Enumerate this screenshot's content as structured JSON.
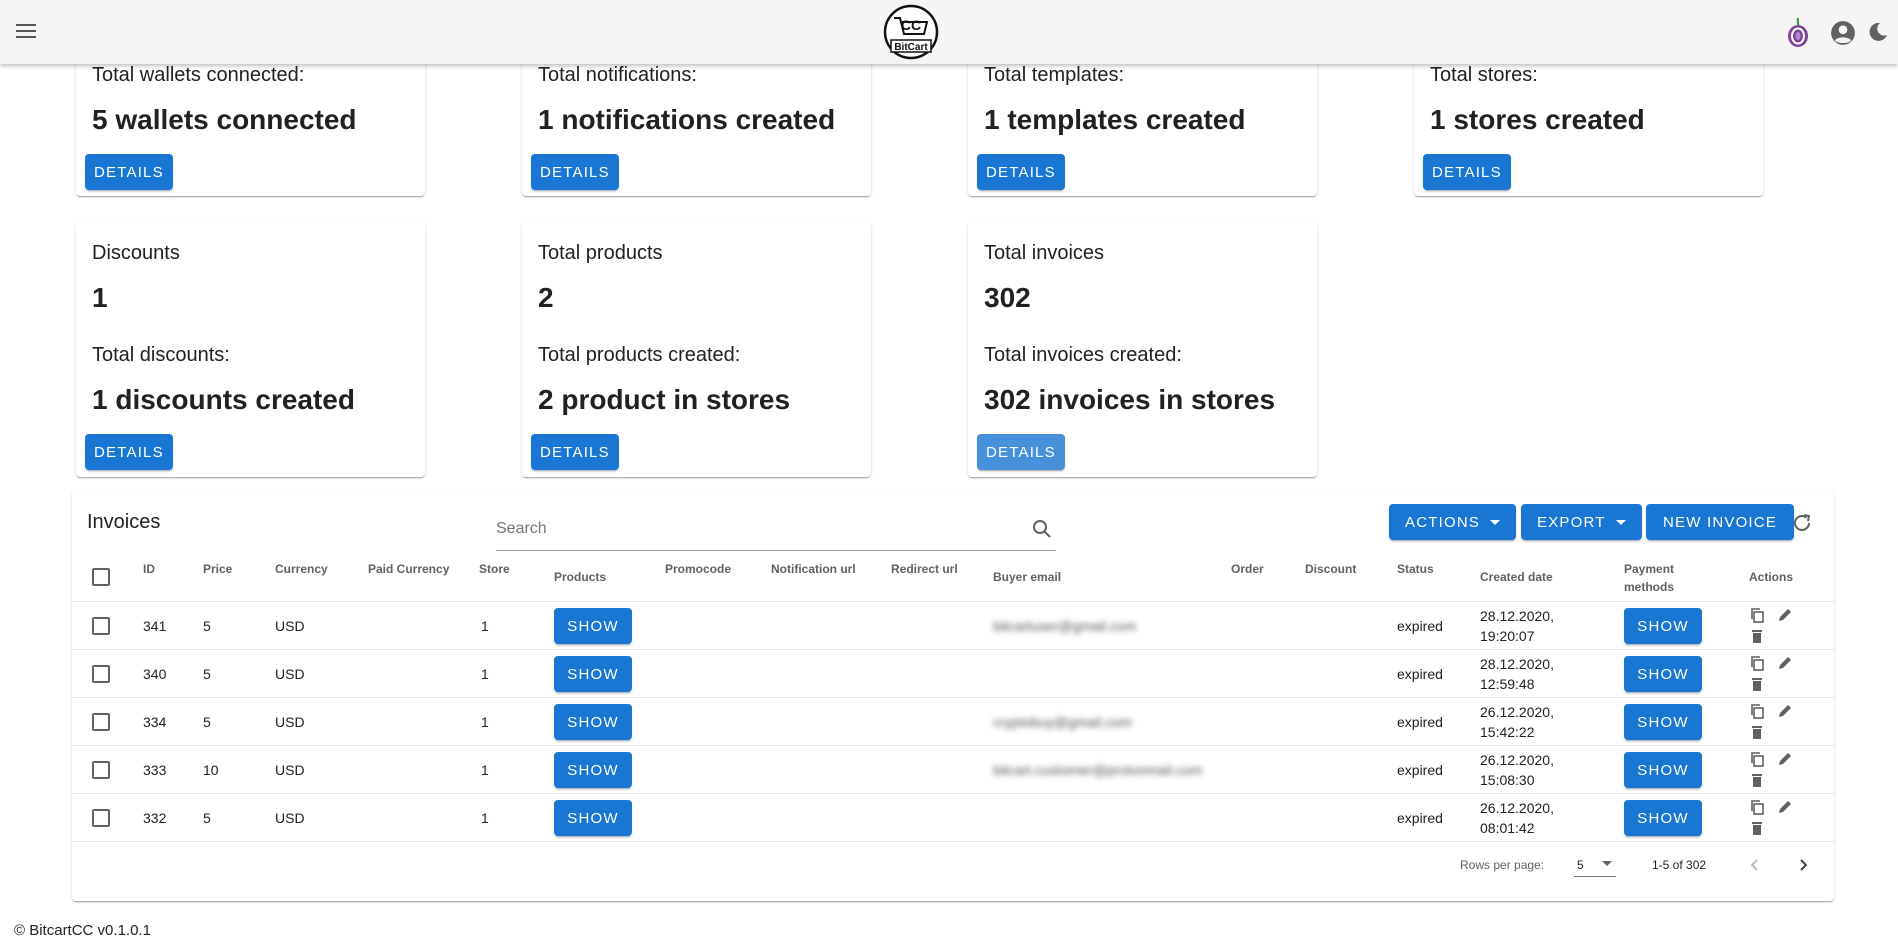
{
  "appbar": {
    "logo_text_top": "CC",
    "logo_text_bottom": "BitCart"
  },
  "cards": [
    {
      "label": "Total wallets connected:",
      "value": "5 wallets connected",
      "button": "DETAILS"
    },
    {
      "label": "Total notifications:",
      "value": "1 notifications created",
      "button": "DETAILS"
    },
    {
      "label": "Total templates:",
      "value": "1 templates created",
      "button": "DETAILS"
    },
    {
      "label": "Total stores:",
      "value": "1 stores created",
      "button": "DETAILS"
    },
    {
      "label": "Discounts",
      "count": "1",
      "label2": "Total discounts:",
      "value": "1 discounts created",
      "button": "DETAILS"
    },
    {
      "label": "Total products",
      "count": "2",
      "label2": "Total products created:",
      "value": "2 product in stores",
      "button": "DETAILS"
    },
    {
      "label": "Total invoices",
      "count": "302",
      "label2": "Total invoices created:",
      "value": "302 invoices in stores",
      "button": "DETAILS"
    }
  ],
  "invoices": {
    "title": "Invoices",
    "search_placeholder": "Search",
    "actions_label": "ACTIONS",
    "export_label": "EXPORT",
    "new_invoice_label": "NEW INVOICE",
    "headers": {
      "id": "ID",
      "price": "Price",
      "currency": "Currency",
      "paid_currency": "Paid Currency",
      "store": "Store",
      "products": "Products",
      "promocode": "Promocode",
      "notification_url": "Notification url",
      "redirect_url": "Redirect url",
      "buyer_email": "Buyer email",
      "order": "Order",
      "discount": "Discount",
      "status": "Status",
      "created_date": "Created date",
      "payment_methods_1": "Payment",
      "payment_methods_2": "methods",
      "actions": "Actions"
    },
    "rows": [
      {
        "id": "341",
        "price": "5",
        "currency": "USD",
        "store": "1",
        "products_btn": "SHOW",
        "buyer_email": "bitcartuser@gmail.com",
        "status": "expired",
        "date": "28.12.2020,",
        "time": "19:20:07",
        "payment_btn": "SHOW"
      },
      {
        "id": "340",
        "price": "5",
        "currency": "USD",
        "store": "1",
        "products_btn": "SHOW",
        "buyer_email": "",
        "status": "expired",
        "date": "28.12.2020,",
        "time": "12:59:48",
        "payment_btn": "SHOW"
      },
      {
        "id": "334",
        "price": "5",
        "currency": "USD",
        "store": "1",
        "products_btn": "SHOW",
        "buyer_email": "cryptobuy@gmail.com",
        "status": "expired",
        "date": "26.12.2020,",
        "time": "15:42:22",
        "payment_btn": "SHOW"
      },
      {
        "id": "333",
        "price": "10",
        "currency": "USD",
        "store": "1",
        "products_btn": "SHOW",
        "buyer_email": "bitcart.customer@protonmail.com",
        "status": "expired",
        "date": "26.12.2020,",
        "time": "15:08:30",
        "payment_btn": "SHOW"
      },
      {
        "id": "332",
        "price": "5",
        "currency": "USD",
        "store": "1",
        "products_btn": "SHOW",
        "buyer_email": "",
        "status": "expired",
        "date": "26.12.2020,",
        "time": "08:01:42",
        "payment_btn": "SHOW"
      }
    ],
    "rows_per_page_label": "Rows per page:",
    "rows_per_page_value": "5",
    "page_range": "1-5 of 302"
  },
  "footer": {
    "copyright": "© BitcartCC v0.1.0.1"
  },
  "colors": {
    "primary": "#1976d2",
    "primary_disabled": "#4791db",
    "appbar": "#f5f5f5"
  }
}
